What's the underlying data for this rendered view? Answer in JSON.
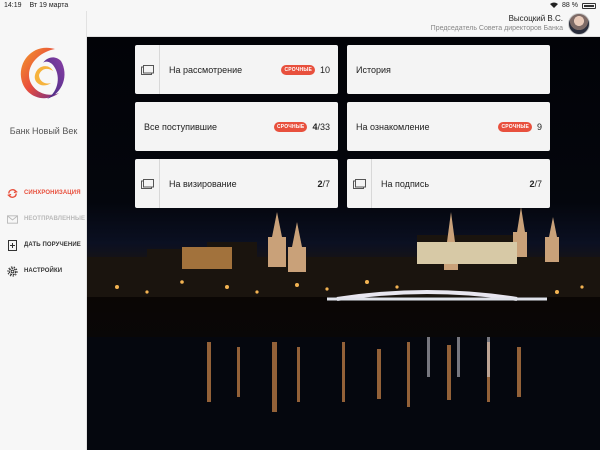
{
  "status_bar": {
    "time": "14:19",
    "date": "Вт 19 марта",
    "battery": "88 %"
  },
  "sidebar": {
    "bank_name": "Банк Новый Век",
    "menu": [
      {
        "label": "СИНХРОНИЗАЦИЯ",
        "icon": "sync-icon"
      },
      {
        "label": "НЕОТПРАВЛЕННЫЕ",
        "icon": "envelope-icon"
      },
      {
        "label": "ДАТЬ ПОРУЧЕНИЕ",
        "icon": "assign-task-icon"
      },
      {
        "label": "НАСТРОЙКИ",
        "icon": "gear-icon"
      }
    ]
  },
  "user": {
    "name": "Высоцкий В.С.",
    "role": "Председатель Совета директоров Банка"
  },
  "cards": {
    "review": {
      "title": "На рассмотрение",
      "badge": "СРОЧНЫЕ",
      "count": "10"
    },
    "history": {
      "title": "История"
    },
    "all_incoming": {
      "title": "Все поступившие",
      "badge": "СРОЧНЫЕ",
      "count_bold": "4",
      "count_rest": "/33"
    },
    "acquaint": {
      "title": "На ознакомление",
      "badge": "СРОЧНЫЕ",
      "count": "9"
    },
    "visa": {
      "title": "На визирование",
      "count_bold": "2",
      "count_rest": "/7"
    },
    "signature": {
      "title": "На подпись",
      "count_bold": "2",
      "count_rest": "/7"
    }
  },
  "colors": {
    "accent": "#e8503d",
    "muted": "#b9b9b9"
  }
}
